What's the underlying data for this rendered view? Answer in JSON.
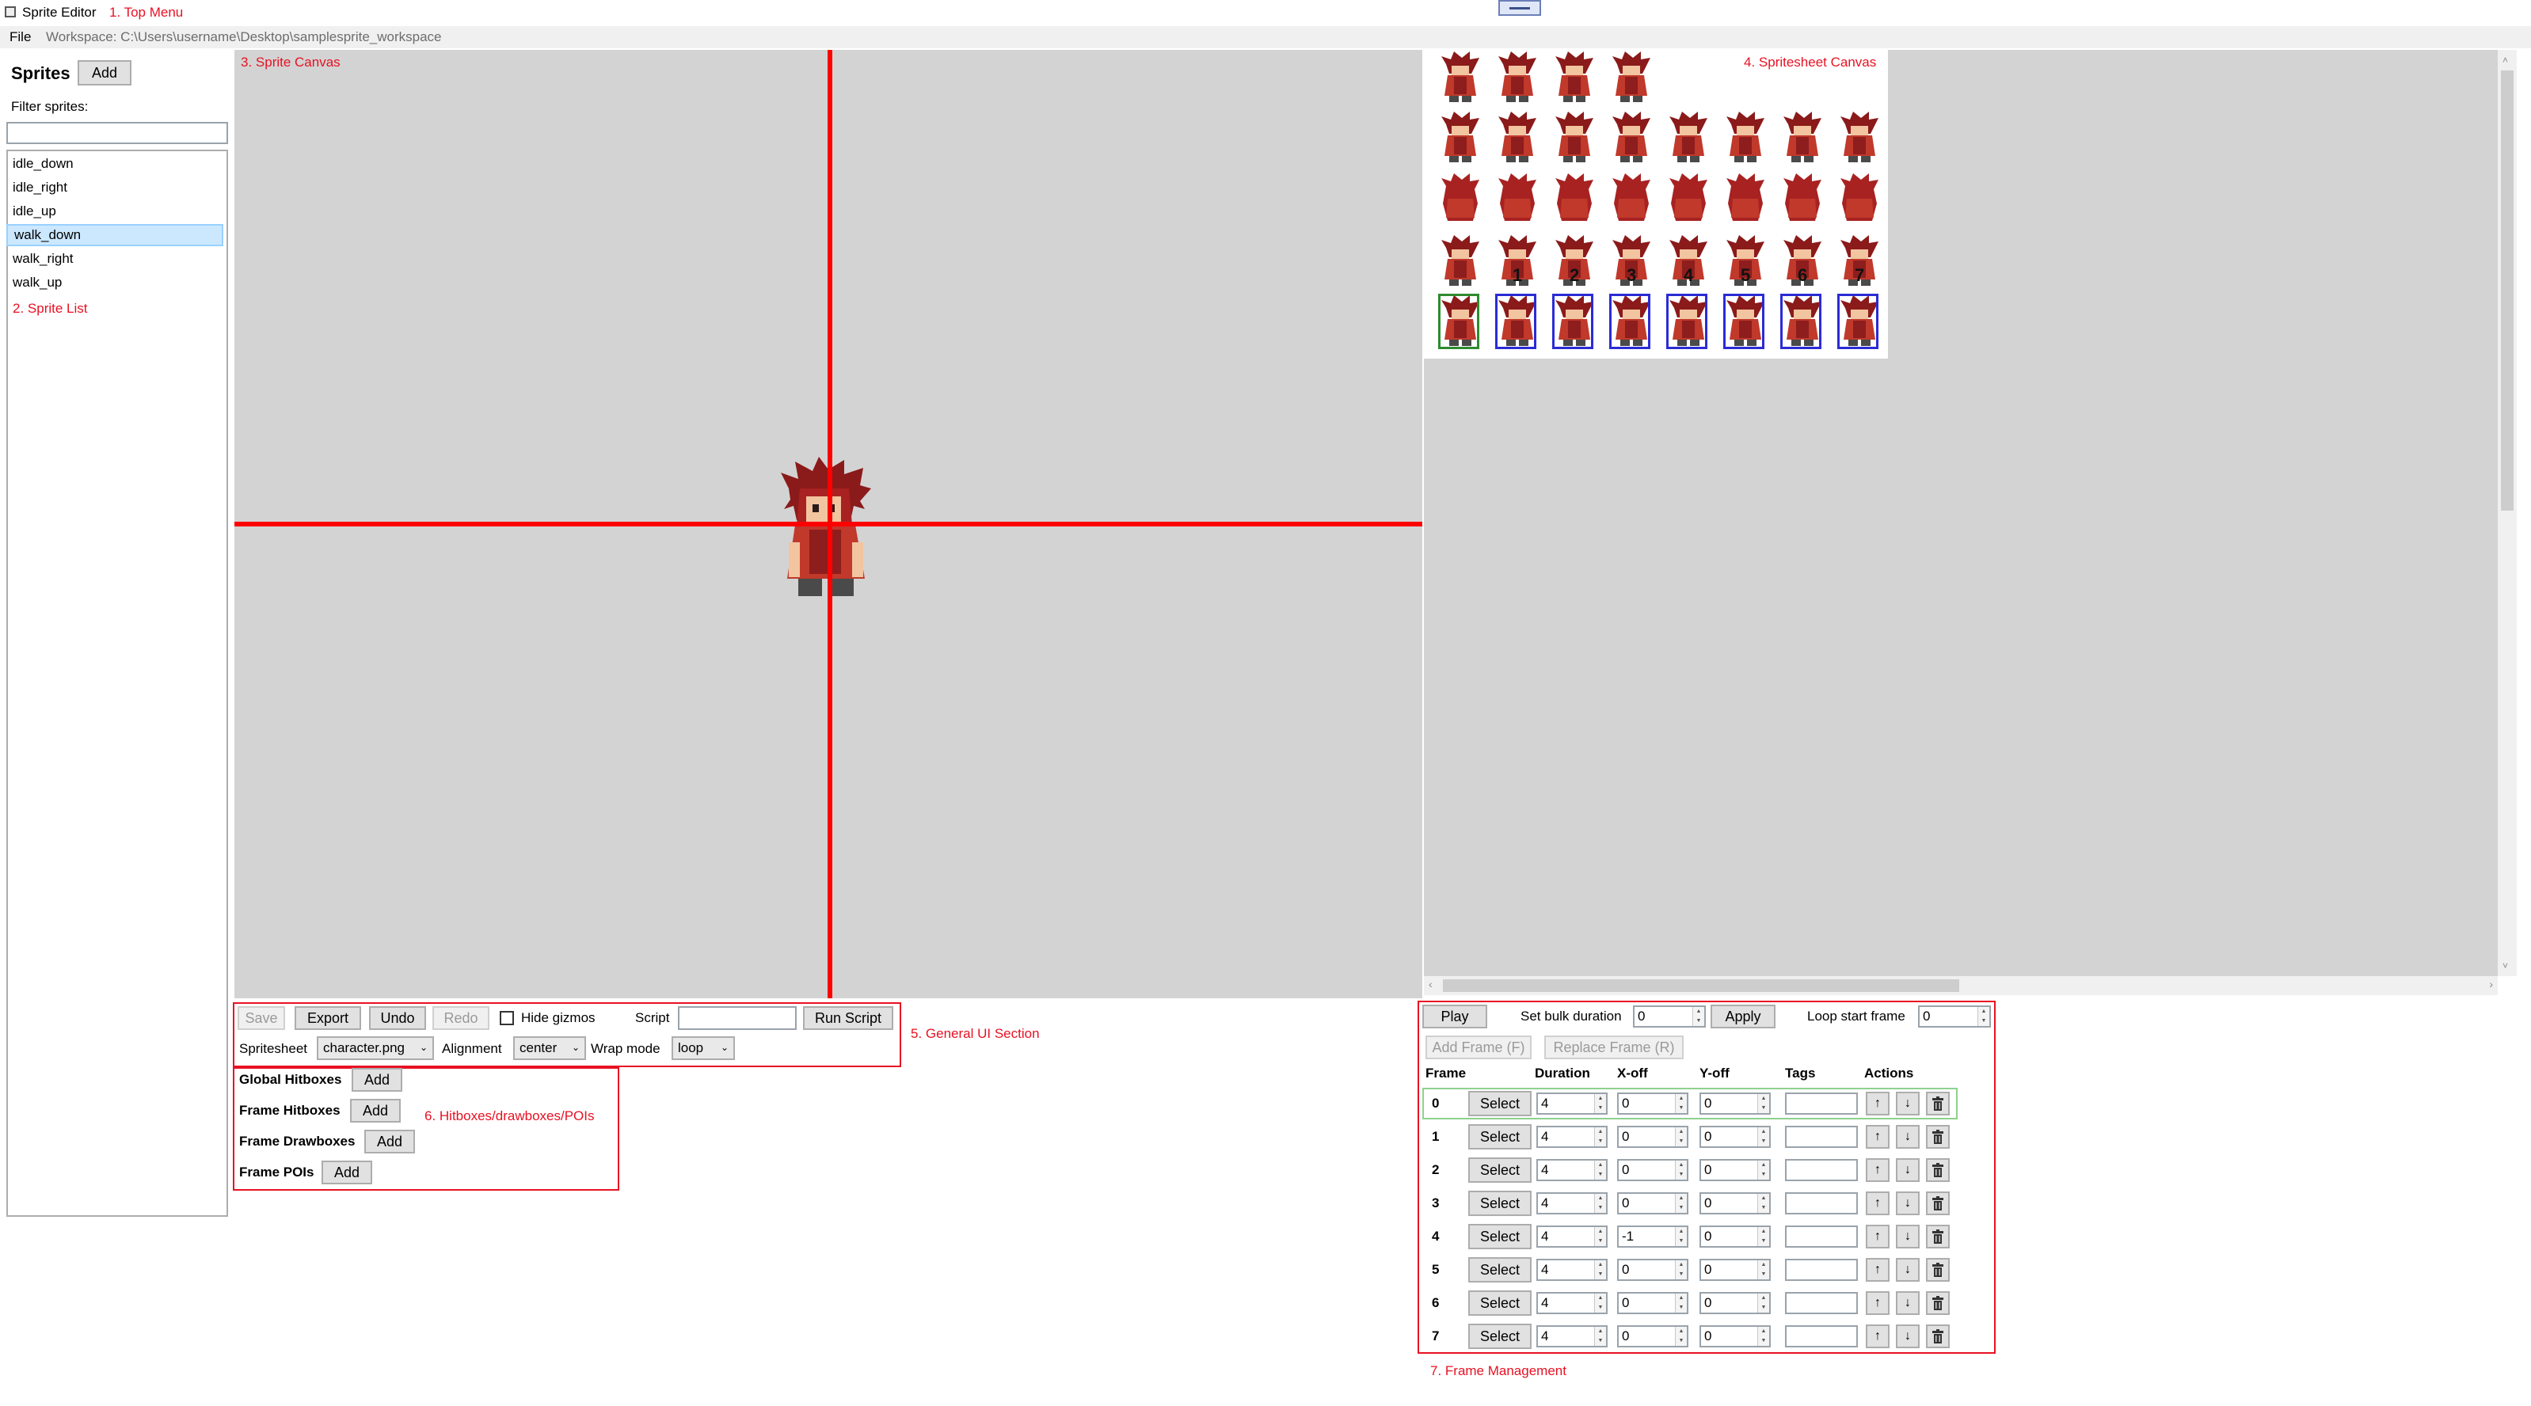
{
  "window": {
    "title": "Sprite Editor",
    "annotation": "1. Top Menu",
    "menu_file": "File",
    "workspace": "Workspace: C:\\Users\\username\\Desktop\\samplesprite_workspace"
  },
  "sprites_panel": {
    "title": "Sprites",
    "add_label": "Add",
    "filter_label": "Filter sprites:",
    "filter_value": "",
    "items": [
      "idle_down",
      "idle_right",
      "idle_up",
      "walk_down",
      "walk_right",
      "walk_up"
    ],
    "selected": "walk_down",
    "annotation": "2. Sprite List"
  },
  "sprite_canvas": {
    "annotation": "3. Sprite Canvas"
  },
  "spritesheet_canvas": {
    "annotation": "4. Spritesheet Canvas",
    "frame_numbers": [
      "1",
      "2",
      "3",
      "4",
      "5",
      "6",
      "7",
      "8"
    ]
  },
  "general": {
    "annotation": "5. General UI Section",
    "save": "Save",
    "export": "Export",
    "undo": "Undo",
    "redo": "Redo",
    "hide_gizmos": "Hide gizmos",
    "script_label": "Script",
    "script_value": "",
    "run_script": "Run Script",
    "spritesheet_label": "Spritesheet",
    "spritesheet_value": "character.png",
    "alignment_label": "Alignment",
    "alignment_value": "center",
    "wrap_label": "Wrap mode",
    "wrap_value": "loop"
  },
  "hitboxes": {
    "annotation": "6. Hitboxes/drawboxes/POIs",
    "global_hitboxes": "Global Hitboxes",
    "frame_hitboxes": "Frame Hitboxes",
    "frame_drawboxes": "Frame Drawboxes",
    "frame_pois": "Frame POIs",
    "add": "Add"
  },
  "frames": {
    "annotation": "7. Frame Management",
    "play": "Play",
    "bulk_label": "Set bulk duration",
    "bulk_value": "0",
    "apply": "Apply",
    "loop_label": "Loop start frame",
    "loop_value": "0",
    "add_frame": "Add Frame (F)",
    "replace_frame": "Replace Frame (R)",
    "headers": [
      "Frame",
      "Duration",
      "X-off",
      "Y-off",
      "Tags",
      "Actions"
    ],
    "select_label": "Select",
    "up_arrow": "↑",
    "down_arrow": "↓",
    "rows": [
      {
        "frame": "0",
        "duration": "4",
        "xoff": "0",
        "yoff": "0"
      },
      {
        "frame": "1",
        "duration": "4",
        "xoff": "0",
        "yoff": "0"
      },
      {
        "frame": "2",
        "duration": "4",
        "xoff": "0",
        "yoff": "0"
      },
      {
        "frame": "3",
        "duration": "4",
        "xoff": "0",
        "yoff": "0"
      },
      {
        "frame": "4",
        "duration": "4",
        "xoff": "-1",
        "yoff": "0"
      },
      {
        "frame": "5",
        "duration": "4",
        "xoff": "0",
        "yoff": "0"
      },
      {
        "frame": "6",
        "duration": "4",
        "xoff": "0",
        "yoff": "0"
      },
      {
        "frame": "7",
        "duration": "4",
        "xoff": "0",
        "yoff": "0"
      }
    ]
  },
  "colors": {
    "annotation_red": "#e81123",
    "canvas_bg": "#d3d3d3",
    "crosshair": "#ff0000",
    "selected_frame_outline": "#2e8b2e",
    "frame_outline": "#2b2bd6",
    "selection_bg": "#cce8ff"
  }
}
